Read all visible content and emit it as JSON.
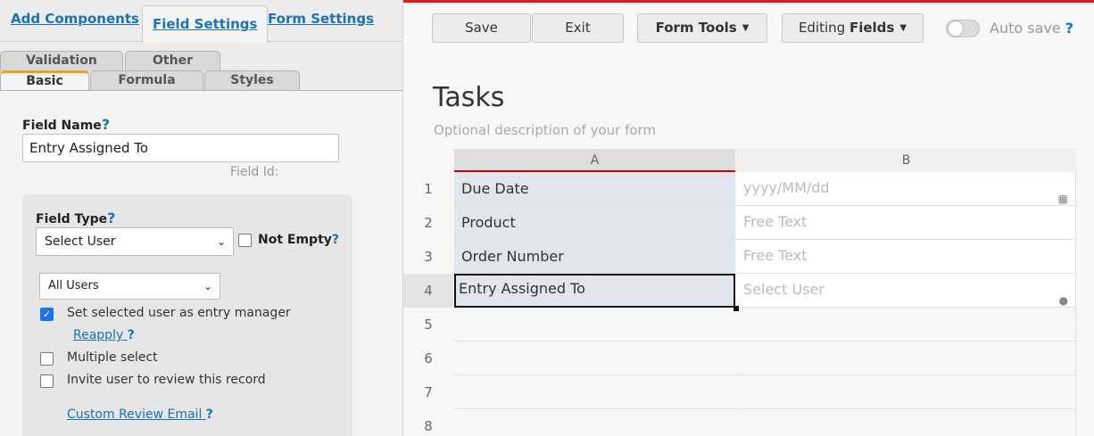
{
  "left_panel": {
    "main_tabs": [
      {
        "label": "Add Components"
      },
      {
        "label": "Field Settings"
      },
      {
        "label": "Form Settings"
      }
    ],
    "sub_tabs": [
      {
        "label": "Validation"
      },
      {
        "label": "Other"
      },
      {
        "label": "Basic"
      },
      {
        "label": "Formula"
      },
      {
        "label": "Styles"
      }
    ],
    "field_name_label": "Field Name",
    "help_mark": "?",
    "field_name_value": "Entry Assigned To",
    "field_id_label": "Field Id:",
    "field_type_label": "Field Type",
    "field_type_value": "Select User",
    "not_empty_label": "Not Empty",
    "users_scope_value": "All Users",
    "options": {
      "set_entry_manager": "Set selected user as entry manager",
      "reapply": "Reapply",
      "multiple_select": "Multiple select",
      "invite_review": "Invite user to review this record",
      "custom_review_email": "Custom Review Email"
    }
  },
  "toolbar": {
    "save": "Save",
    "exit": "Exit",
    "form_tools": "Form Tools",
    "editing_prefix": "Editing",
    "editing_bold": "Fields",
    "auto_save": "Auto save",
    "help": "?"
  },
  "form": {
    "title": "Tasks",
    "description": "Optional description of your form",
    "columns": [
      "A",
      "B"
    ],
    "rows": [
      {
        "num": "1",
        "a": "Due Date",
        "b": "yyyy/MM/dd",
        "b_icon": "calendar-icon"
      },
      {
        "num": "2",
        "a": "Product",
        "b": "Free Text"
      },
      {
        "num": "3",
        "a": "Order Number",
        "b": "Free Text"
      },
      {
        "num": "4",
        "a": "Entry Assigned To",
        "b": "Select User",
        "b_icon": "user-icon"
      },
      {
        "num": "5",
        "a": "",
        "b": ""
      },
      {
        "num": "6",
        "a": "",
        "b": ""
      },
      {
        "num": "7",
        "a": "",
        "b": ""
      },
      {
        "num": "8",
        "a": "",
        "b": ""
      }
    ]
  },
  "colors": {
    "accent": "#1a73b5",
    "topline": "#d81e1e",
    "tab_highlight": "#f0a020"
  }
}
